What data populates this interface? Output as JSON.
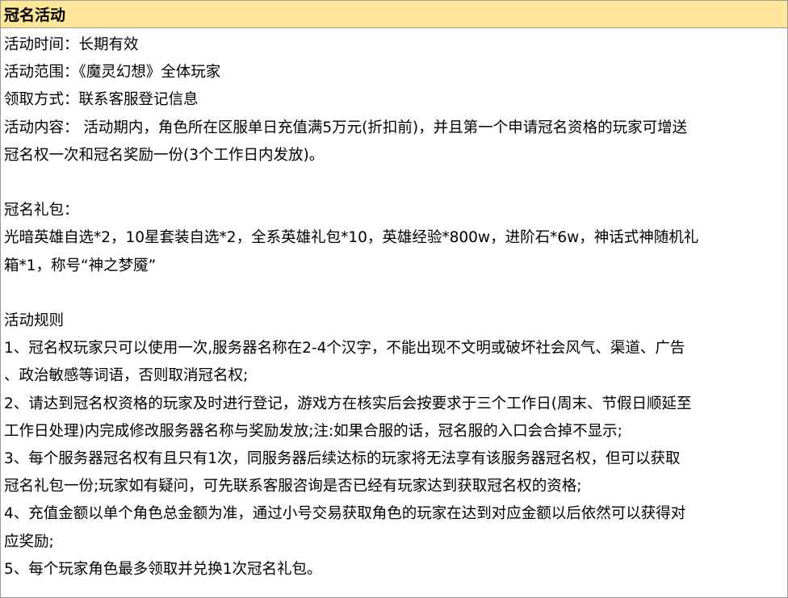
{
  "title": "冠名活动",
  "lines": {
    "time": "活动时间：长期有效",
    "scope": "活动范围：《魔灵幻想》全体玩家",
    "claim": "领取方式：联系客服登记信息",
    "content_1": "活动内容： 活动期内，角色所在区服单日充值满5万元(折扣前)，并且第一个申请冠名资格的玩家可增送",
    "content_2": "冠名权一次和冠名奖励一份(3个工作日内发放)。",
    "gift_heading": "冠名礼包：",
    "gift_1": "光暗英雄自选*2，10星套装自选*2，全系英雄礼包*10，英雄经验*800w，进阶石*6w，神话式神随机礼",
    "gift_2": "箱*1，称号“神之梦魇”",
    "rules_heading": "活动规则",
    "rule1_a": "1、冠名权玩家只可以使用一次,服务器名称在2-4个汉字，不能出现不文明或破坏社会风气、渠道、广告",
    "rule1_b": "、政治敏感等词语，否则取消冠名权;",
    "rule2_a": "2、请达到冠名权资格的玩家及时进行登记，游戏方在核实后会按要求于三个工作日(周末、节假日顺延至",
    "rule2_b": "工作日处理)内完成修改服务器名称与奖励发放;注:如果合服的话，冠名服的入口会合掉不显示;",
    "rule3_a": "3、每个服务器冠名权有且只有1次，同服务器后续达标的玩家将无法享有该服务器冠名权，但可以获取",
    "rule3_b": "冠名礼包一份;玩家如有疑问，可先联系客服咨询是否已经有玩家达到获取冠名权的资格;",
    "rule4_a": "4、充值金额以单个角色总金额为准，通过小号交易获取角色的玩家在达到对应金额以后依然可以获得对",
    "rule4_b": "应奖励;",
    "rule5": "5、每个玩家角色最多领取并兑换1次冠名礼包。"
  },
  "colors": {
    "header_bg": "#ffe699",
    "border": "#9a9a9a"
  }
}
